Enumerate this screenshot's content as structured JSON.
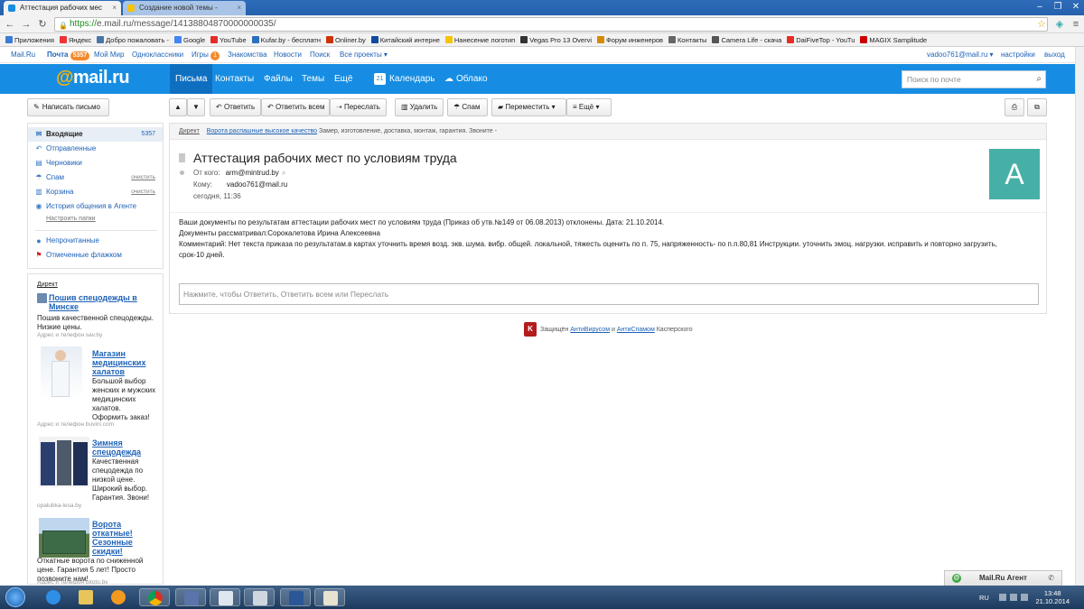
{
  "browser": {
    "tabs": [
      {
        "title": "Аттестация рабочих мес",
        "active": true
      },
      {
        "title": "Создание новой темы - ",
        "active": false
      }
    ],
    "url_scheme": "https://",
    "url_rest": "e.mail.ru/message/14138804870000000035/",
    "bookmarks": [
      {
        "label": "Приложения",
        "color": "#3b7bd6"
      },
      {
        "label": "Яндекс",
        "color": "#e33"
      },
      {
        "label": "Добро пожаловать -",
        "color": "#4a76a8"
      },
      {
        "label": "Google",
        "color": "#4285f4"
      },
      {
        "label": "YouTube",
        "color": "#e52d27"
      },
      {
        "label": "Kufar.by - бесплатн",
        "color": "#2c6fbc"
      },
      {
        "label": "Onliner.by",
        "color": "#c30"
      },
      {
        "label": "Китайский интерне",
        "color": "#114a9e"
      },
      {
        "label": "Нанесение логотип",
        "color": "#f5c400"
      },
      {
        "label": "Vegas Pro 13 Overvi",
        "color": "#333"
      },
      {
        "label": "Форум инженеров",
        "color": "#d48a00"
      },
      {
        "label": "Контакты",
        "color": "#666"
      },
      {
        "label": "Camera Life - скача",
        "color": "#555"
      },
      {
        "label": "DaiFiveTop - YouTu",
        "color": "#e52d27"
      },
      {
        "label": "MAGIX Samplitude",
        "color": "#c00"
      }
    ]
  },
  "topnav": {
    "items": [
      "Mail.Ru",
      "Почта",
      "Мой Мир",
      "Одноклассники",
      "Игры",
      "Знакомства",
      "Новости",
      "Поиск",
      "Все проекты ▾"
    ],
    "mail_count": "5357",
    "games_badge": "1",
    "user": "vadoo761@mail.ru ▾",
    "settings": "настройки",
    "logout": "выход"
  },
  "mainbar": {
    "logo_at": "@",
    "logo_text": "mail.ru",
    "nav": [
      "Письма",
      "Контакты",
      "Файлы",
      "Темы",
      "Ещё"
    ],
    "calendar": "Календарь",
    "calendar_day": "21",
    "cloud": "Облако",
    "search_placeholder": "Поиск по почте"
  },
  "sidebar": {
    "compose": "Написать письмо",
    "folders": [
      {
        "label": "Входящие",
        "count": "5357",
        "icon": "inbox-icon",
        "glyph": "✉"
      },
      {
        "label": "Отправленные",
        "icon": "sent-icon",
        "glyph": "↶"
      },
      {
        "label": "Черновики",
        "icon": "drafts-icon",
        "glyph": "▤"
      },
      {
        "label": "Спам",
        "action": "очистить",
        "icon": "spam-icon",
        "glyph": "☂"
      },
      {
        "label": "Корзина",
        "action": "очистить",
        "icon": "trash-icon",
        "glyph": "🗑"
      },
      {
        "label": "История общения в Агенте",
        "icon": "agent-history-icon",
        "glyph": "◉"
      }
    ],
    "setup_folders": "Настроить папки",
    "unread": "Непрочитанные",
    "flagged": "Отмеченные флажком"
  },
  "ads": {
    "header": "Директ",
    "items": [
      {
        "title": "Пошив спецодежды в Минске",
        "text": "Пошив качественной спецодежды. Низкие цены.",
        "src": "Адрес и телефон  sav.by"
      },
      {
        "title": "Магазин медицинских халатов",
        "text": "Большой выбор женских и мужских медицинских халатов. Оформить заказ!",
        "src": "Адрес и телефон  buvini.com"
      },
      {
        "title": "Зимняя спецодежда",
        "text": "Качественная спецодежда по низкой цене. Широкий выбор. Гарантия. Звони!",
        "src": "opalubka-lesa.by"
      },
      {
        "title": "Ворота откатные! Сезонные скидки!",
        "text": "Откатные ворота по сниженной цене. Гарантия 5 лет! Просто позвоните нам!",
        "src": "Адрес и телефон  bitoto.by"
      }
    ]
  },
  "toolbar": {
    "up": "▲",
    "down": "▼",
    "reply": "Ответить",
    "reply_all": "Ответить всем",
    "forward": "Переслать",
    "delete": "Удалить",
    "spam": "Спам",
    "move": "Переместить ▾",
    "more": "Ещё ▾"
  },
  "message": {
    "direct_label": "Директ",
    "direct_link": "Ворота распашные высокое качество",
    "direct_text": "Замер, изготовление, доставка, монтаж, гарантия. Звоните -",
    "subject": "Аттестация рабочих мест по условиям труда",
    "from_label": "От кого:",
    "from": "arm@mintrud.by",
    "to_label": "Кому:",
    "to": "vadoo761@mail.ru",
    "date": "сегодня, 11:36",
    "avatar_letter": "A",
    "avatar_color": "#47b0a6",
    "body": [
      "Ваши документы по результатам аттестации рабочих мест по условиям труда (Приказ об утв.№149 от 06.08.2013) отклонены. Дата: 21.10.2014.",
      " Документы рассматривал:Сорокалетова Ирина Алексеевна",
      " Комментарий: Нет текста приказа по результатам.в картах уточнить время возд. экв. шума. вибр. общей. локальной, тяжесть оценить по п. 75, напряженность- по п.п.80,81 Инструкции. уточнить эмоц. нагрузки. исправить и повторно загрузить,",
      "срок-10 дней."
    ],
    "reply_placeholder": "Нажмите, чтобы Ответить, Ответить всем или Переслать"
  },
  "kaspersky": {
    "prefix": "Защищён",
    "antivirus": "АнтиВирусом",
    "and": "и",
    "antispam": "АнтиСпамом",
    "suffix": "Касперского"
  },
  "agent": {
    "label": "Mail.Ru Агент"
  },
  "taskbar": {
    "lang": "RU",
    "time": "13:48",
    "date": "21.10.2014"
  },
  "colors": {
    "brand_blue": "#168de2",
    "link": "#1d62b7",
    "accent_orange": "#f48a2a"
  }
}
